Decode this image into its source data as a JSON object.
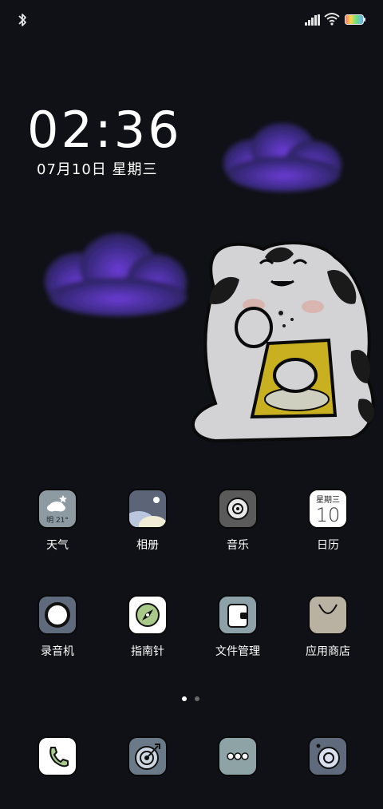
{
  "status_bar": {
    "icons": [
      "bluetooth-icon",
      "signal-icon",
      "wifi-icon",
      "battery-icon"
    ]
  },
  "clock": {
    "time": "02:36",
    "date": "07月10日 星期三"
  },
  "apps_row1": [
    {
      "label": "天气",
      "icon": "weather-icon",
      "detail": "明 21°"
    },
    {
      "label": "相册",
      "icon": "gallery-icon"
    },
    {
      "label": "音乐",
      "icon": "music-icon"
    },
    {
      "label": "日历",
      "icon": "calendar-icon",
      "weekday": "星期三",
      "day": "10"
    }
  ],
  "apps_row2": [
    {
      "label": "录音机",
      "icon": "recorder-icon"
    },
    {
      "label": "指南针",
      "icon": "compass-icon"
    },
    {
      "label": "文件管理",
      "icon": "file-manager-icon"
    },
    {
      "label": "应用商店",
      "icon": "app-store-icon"
    }
  ],
  "dock": [
    {
      "icon": "phone-icon"
    },
    {
      "icon": "browser-icon"
    },
    {
      "icon": "messages-icon"
    },
    {
      "icon": "camera-icon"
    }
  ],
  "page_indicator": {
    "pages": 2,
    "current": 1
  },
  "colors": {
    "background": "#101116",
    "cloud_purple": "#5a2fb8",
    "weather_tile": "#8d9aa1",
    "gallery_tile": "#5c6478",
    "music_tile": "#5a5a5a",
    "calendar_tile": "#ffffff",
    "recorder_tile": "#5f6b7c",
    "compass_tile": "#ffffff",
    "files_tile": "#8da2a8",
    "store_tile": "#b9b2a3",
    "phone_tile": "#ffffff",
    "browser_tile": "#6b7a88",
    "messages_tile": "#8ea3a6",
    "camera_tile": "#5f6b7c"
  }
}
